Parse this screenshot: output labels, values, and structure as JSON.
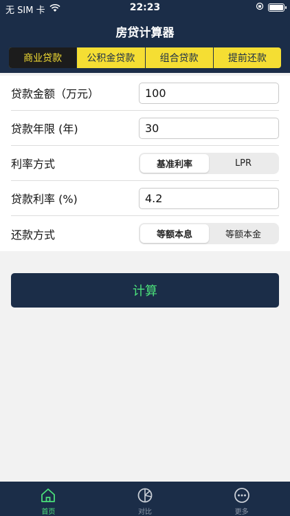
{
  "status_bar": {
    "carrier": "无 SIM 卡",
    "time": "22:23"
  },
  "nav": {
    "title": "房贷计算器"
  },
  "tabs": [
    {
      "label": "商业贷款",
      "active": true
    },
    {
      "label": "公积金贷款",
      "active": false
    },
    {
      "label": "组合贷款",
      "active": false
    },
    {
      "label": "提前还款",
      "active": false
    }
  ],
  "form": {
    "amount": {
      "label": "贷款金额（万元）",
      "value": "100"
    },
    "years": {
      "label": "贷款年限 (年)",
      "value": "30"
    },
    "rate_mode": {
      "label": "利率方式",
      "options": [
        "基准利率",
        "LPR"
      ],
      "selected": "基准利率"
    },
    "rate": {
      "label": "贷款利率 (%)",
      "value": "4.2"
    },
    "repay_mode": {
      "label": "还款方式",
      "options": [
        "等额本息",
        "等额本金"
      ],
      "selected": "等额本息"
    }
  },
  "calc_button": {
    "label": "计算"
  },
  "tabbar": [
    {
      "label": "首页",
      "icon": "home-icon",
      "active": true
    },
    {
      "label": "对比",
      "icon": "compare-icon",
      "active": false
    },
    {
      "label": "更多",
      "icon": "more-icon",
      "active": false
    }
  ],
  "colors": {
    "primary_navy": "#1b2d48",
    "accent_yellow": "#f5de33",
    "accent_green": "#4be07a"
  }
}
